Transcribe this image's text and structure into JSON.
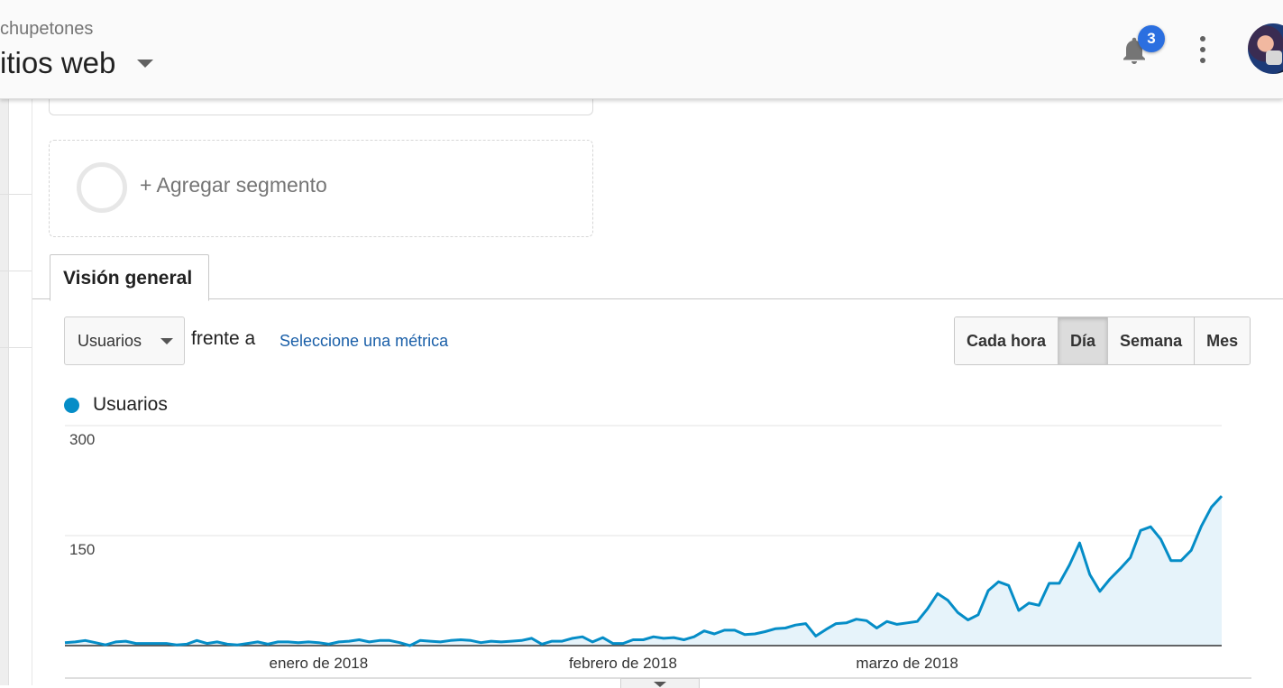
{
  "header": {
    "account": "chupetones",
    "property": "itios web",
    "notifications_count": "3",
    "icons": {
      "bell": "bell-icon",
      "menu": "more-vert-icon",
      "caret": "caret-down-icon"
    }
  },
  "segments": {
    "add_label": "+ Agregar segmento"
  },
  "tabs": [
    {
      "label": "Visión general",
      "active": true
    }
  ],
  "controls": {
    "metric_selected": "Usuarios",
    "vs_label": "frente a",
    "metric_link": "Seleccione una métrica",
    "granularity": [
      {
        "label": "Cada hora",
        "active": false
      },
      {
        "label": "Día",
        "active": true
      },
      {
        "label": "Semana",
        "active": false
      },
      {
        "label": "Mes",
        "active": false
      }
    ]
  },
  "colors": {
    "series": "#058dc7",
    "series_fill": "#e6f3fa",
    "accent_badge": "#2b6fe0",
    "link": "#1a5fa8"
  },
  "chart_data": {
    "type": "area",
    "series": [
      {
        "name": "Usuarios",
        "values": [
          4,
          5,
          7,
          4,
          1,
          5,
          6,
          3,
          3,
          3,
          3,
          1,
          2,
          7,
          3,
          5,
          2,
          1,
          3,
          5,
          2,
          5,
          5,
          4,
          5,
          4,
          2,
          5,
          6,
          8,
          5,
          7,
          7,
          4,
          0,
          7,
          6,
          5,
          7,
          8,
          7,
          4,
          6,
          5,
          6,
          7,
          10,
          2,
          6,
          6,
          10,
          12,
          5,
          11,
          3,
          3,
          8,
          8,
          12,
          10,
          11,
          8,
          12,
          20,
          16,
          21,
          21,
          15,
          16,
          19,
          23,
          24,
          28,
          30,
          13,
          22,
          30,
          31,
          36,
          34,
          24,
          33,
          29,
          31,
          33,
          50,
          71,
          62,
          45,
          35,
          42,
          75,
          87,
          82,
          48,
          58,
          55,
          85,
          85,
          110,
          140,
          97,
          74,
          91,
          105,
          120,
          157,
          162,
          145,
          116,
          116,
          130,
          163,
          189,
          204
        ]
      }
    ],
    "x_labels": [
      "enero de 2018",
      "febrero de 2018",
      "marzo de 2018"
    ],
    "x_label_indices": [
      25,
      55,
      83
    ],
    "y_ticks": [
      150,
      300
    ],
    "ylim": [
      0,
      300
    ],
    "grid": true,
    "legend": "top-left"
  }
}
